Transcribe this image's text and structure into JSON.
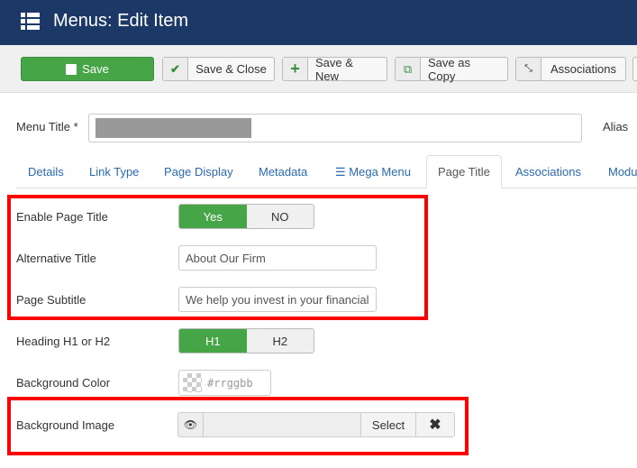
{
  "header": {
    "title": "Menus: Edit Item",
    "icon": "menu-list-icon"
  },
  "toolbar": {
    "save": "Save",
    "save_close": "Save & Close",
    "save_new": "Save & New",
    "save_copy": "Save as Copy",
    "associations": "Associations"
  },
  "form": {
    "menu_title_label": "Menu Title *",
    "alias_label": "Alias"
  },
  "tabs": [
    "Details",
    "Link Type",
    "Page Display",
    "Metadata",
    "Mega Menu",
    "Page Title",
    "Associations",
    "Modu"
  ],
  "active_tab": "Page Title",
  "fields": {
    "enable_page_title": {
      "label": "Enable Page Title",
      "options": [
        "Yes",
        "NO"
      ],
      "selected": "Yes"
    },
    "alternative_title": {
      "label": "Alternative Title",
      "value": "About Our Firm"
    },
    "page_subtitle": {
      "label": "Page Subtitle",
      "value": "We help you invest in your financial"
    },
    "heading": {
      "label": "Heading H1 or H2",
      "options": [
        "H1",
        "H2"
      ],
      "selected": "H1"
    },
    "background_color": {
      "label": "Background Color",
      "placeholder": "#rrggbb"
    },
    "background_image": {
      "label": "Background Image",
      "select": "Select"
    }
  },
  "colors": {
    "header": "#1b3867",
    "accent_green": "#46a546",
    "highlight": "#ff0000",
    "link": "#2a69b0"
  }
}
